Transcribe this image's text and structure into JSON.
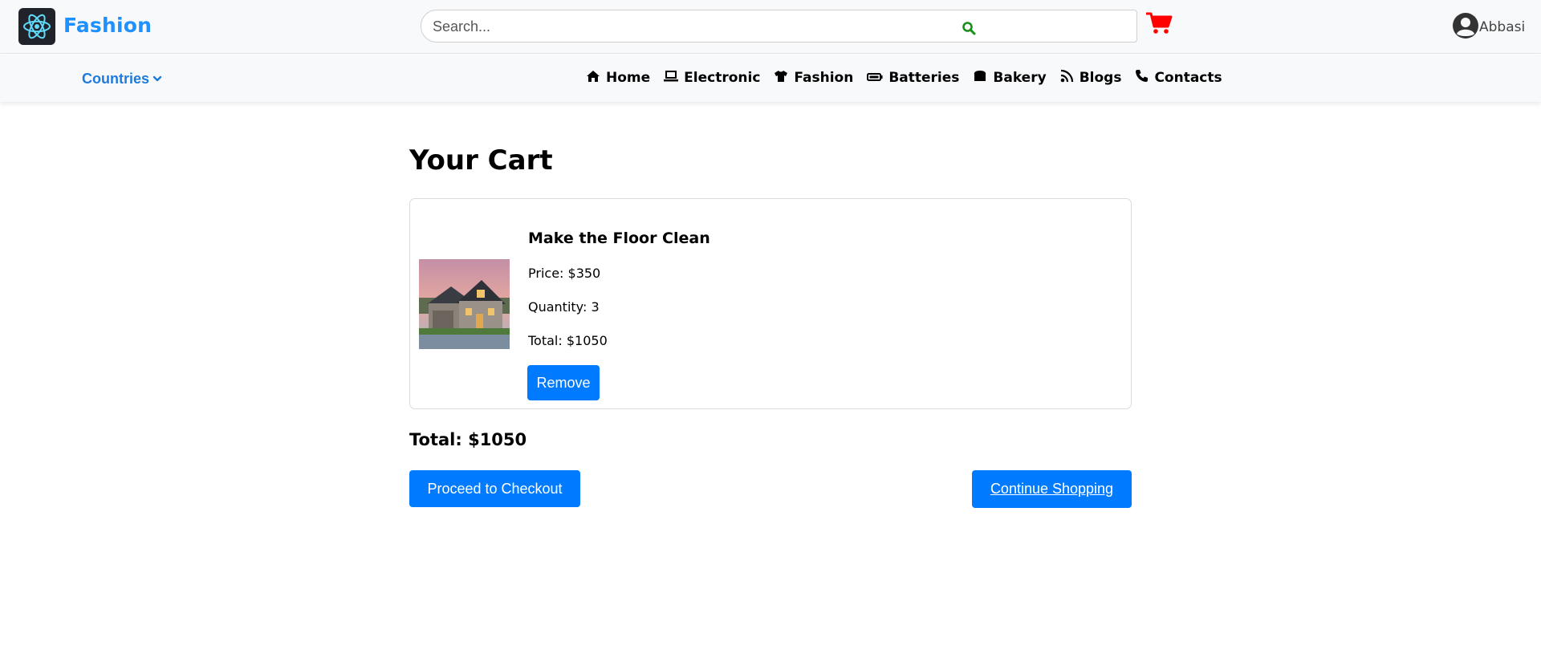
{
  "header": {
    "brand": "Fashion",
    "search_placeholder": "Search...",
    "username": "Abbasi",
    "icons": {
      "logo": "react-atom-icon",
      "search": "search-icon",
      "cart": "shopping-cart-icon",
      "user": "user-circle-icon"
    },
    "colors": {
      "brand": "#1e90ff",
      "search_icon": "#1a8f1a",
      "cart": "#ff0000"
    }
  },
  "navbar": {
    "countries_label": "Countries",
    "items": [
      {
        "label": "Home",
        "icon": "home-icon"
      },
      {
        "label": "Electronic",
        "icon": "laptop-icon"
      },
      {
        "label": "Fashion",
        "icon": "tshirt-icon"
      },
      {
        "label": "Batteries",
        "icon": "battery-icon"
      },
      {
        "label": "Bakery",
        "icon": "bread-icon"
      },
      {
        "label": "Blogs",
        "icon": "rss-icon"
      },
      {
        "label": "Contacts",
        "icon": "phone-icon"
      }
    ]
  },
  "cart": {
    "title": "Your Cart",
    "items": [
      {
        "name": "Make the Floor Clean",
        "price": "Price: $350",
        "quantity": "Quantity: 3",
        "total": "Total: $1050",
        "remove_label": "Remove",
        "image": "house-photo"
      }
    ],
    "grand_total": "Total: $1050",
    "checkout_label": "Proceed to Checkout",
    "continue_label": "Continue Shopping"
  },
  "colors": {
    "primary": "#007bff"
  }
}
